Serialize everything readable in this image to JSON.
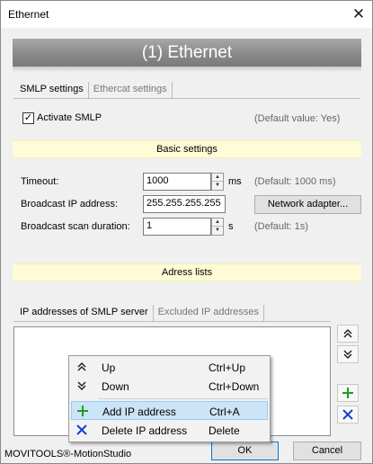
{
  "window": {
    "title": "Ethernet"
  },
  "banner": {
    "title": "(1) Ethernet"
  },
  "tabs_top": {
    "items": [
      "SMLP settings",
      "Ethercat settings"
    ]
  },
  "smlp": {
    "activate_label": "Activate SMLP",
    "activate_checked": true,
    "activate_hint": "(Default value: Yes)"
  },
  "basic": {
    "heading": "Basic settings",
    "timeout_label": "Timeout:",
    "timeout_value": "1000",
    "timeout_unit": "ms",
    "timeout_hint": "(Default: 1000 ms)",
    "broadcast_label": "Broadcast IP address:",
    "broadcast_value": "255.255.255.255",
    "network_button": "Network adapter...",
    "scan_label": "Broadcast scan duration:",
    "scan_value": "1",
    "scan_unit": "s",
    "scan_hint": "(Default: 1s)"
  },
  "adress": {
    "heading": "Adress lists",
    "tabs": [
      "IP addresses of SMLP server",
      "Excluded IP addresses"
    ]
  },
  "context_menu": {
    "items": [
      {
        "label": "Up",
        "shortcut": "Ctrl+Up"
      },
      {
        "label": "Down",
        "shortcut": "Ctrl+Down"
      },
      {
        "label": "Add IP address",
        "shortcut": "Ctrl+A"
      },
      {
        "label": "Delete IP address",
        "shortcut": "Delete"
      }
    ]
  },
  "footer": {
    "app_name": "MOVITOOLS®-MotionStudio",
    "ok": "OK",
    "cancel": "Cancel"
  },
  "colors": {
    "add_green": "#1e9e1e",
    "delete_blue": "#1a3fd1",
    "highlight": "#cce4f7",
    "section_bg": "#fffbd6"
  },
  "icons": {
    "close": "close-icon",
    "up": "double-chevron-up-icon",
    "down": "double-chevron-down-icon",
    "add": "plus-icon",
    "delete": "x-icon"
  }
}
